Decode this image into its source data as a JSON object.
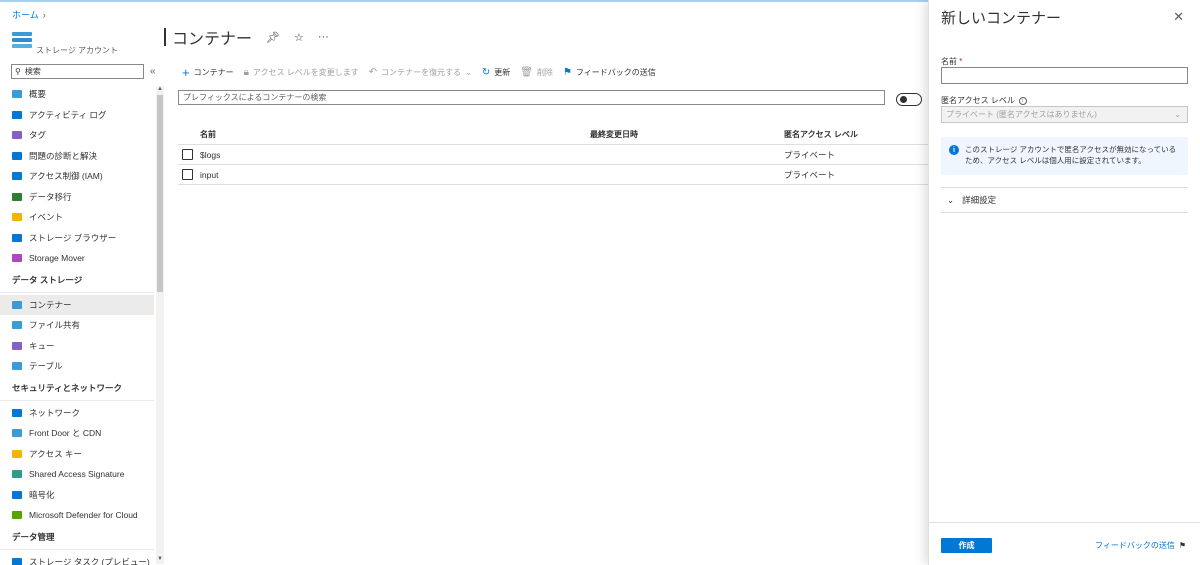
{
  "breadcrumb": {
    "home": "ホーム"
  },
  "resource": {
    "subtitle": "ストレージ アカウント",
    "page_title": "コンテナー"
  },
  "sidebar": {
    "search_placeholder": "検索",
    "items": [
      {
        "label": "概要",
        "icon": "overview-icon",
        "color": "#3a9bd6"
      },
      {
        "label": "アクティビティ ログ",
        "icon": "activity-log-icon",
        "color": "#0078d4"
      },
      {
        "label": "タグ",
        "icon": "tag-icon",
        "color": "#8661c5"
      },
      {
        "label": "問題の診断と解決",
        "icon": "diagnose-icon",
        "color": "#0078d4"
      },
      {
        "label": "アクセス制御 (IAM)",
        "icon": "iam-icon",
        "color": "#0078d4"
      },
      {
        "label": "データ移行",
        "icon": "data-migration-icon",
        "color": "#2e7d32"
      },
      {
        "label": "イベント",
        "icon": "events-icon",
        "color": "#f2b600"
      },
      {
        "label": "ストレージ ブラウザー",
        "icon": "storage-browser-icon",
        "color": "#0078d4"
      },
      {
        "label": "Storage Mover",
        "icon": "storage-mover-icon",
        "color": "#b146c2"
      }
    ],
    "sections": [
      {
        "title": "データ ストレージ",
        "items": [
          {
            "label": "コンテナー",
            "icon": "containers-icon",
            "color": "#3a9bd6",
            "active": true
          },
          {
            "label": "ファイル共有",
            "icon": "file-share-icon",
            "color": "#3a9bd6"
          },
          {
            "label": "キュー",
            "icon": "queue-icon",
            "color": "#8661c5"
          },
          {
            "label": "テーブル",
            "icon": "table-icon",
            "color": "#3a9bd6"
          }
        ]
      },
      {
        "title": "セキュリティとネットワーク",
        "items": [
          {
            "label": "ネットワーク",
            "icon": "network-icon",
            "color": "#0078d4"
          },
          {
            "label": "Front Door と CDN",
            "icon": "front-door-icon",
            "color": "#3a9bd6"
          },
          {
            "label": "アクセス キー",
            "icon": "access-key-icon",
            "color": "#f2b600"
          },
          {
            "label": "Shared Access Signature",
            "icon": "sas-icon",
            "color": "#2e9c8a"
          },
          {
            "label": "暗号化",
            "icon": "encryption-icon",
            "color": "#0078d4"
          },
          {
            "label": "Microsoft Defender for Cloud",
            "icon": "defender-icon",
            "color": "#57a300"
          }
        ]
      },
      {
        "title": "データ管理",
        "items": [
          {
            "label": "ストレージ タスク (プレビュー)",
            "icon": "storage-task-icon",
            "color": "#0078d4"
          }
        ]
      }
    ]
  },
  "toolbar": {
    "add": "コンテナー",
    "change_access": "アクセス レベルを変更します",
    "restore": "コンテナーを復元する",
    "refresh": "更新",
    "delete": "削除",
    "feedback": "フィードバックの送信"
  },
  "filter": {
    "placeholder": "プレフィックスによるコンテナーの検索"
  },
  "table": {
    "headers": {
      "name": "名前",
      "modified": "最終変更日時",
      "access": "匿名アクセス レベル"
    },
    "rows": [
      {
        "name": "$logs",
        "modified": "",
        "access": "プライベート"
      },
      {
        "name": "input",
        "modified": "",
        "access": "プライベート"
      }
    ]
  },
  "panel": {
    "title": "新しいコンテナー",
    "name_label": "名前",
    "name_value": "",
    "access_label": "匿名アクセス レベル",
    "access_value": "プライベート (匿名アクセスはありません)",
    "info_text": "このストレージ アカウントで匿名アクセスが無効になっているため、アクセス レベルは個人用に設定されています。",
    "advanced": "詳細設定",
    "create": "作成",
    "feedback": "フィードバックの送信"
  }
}
